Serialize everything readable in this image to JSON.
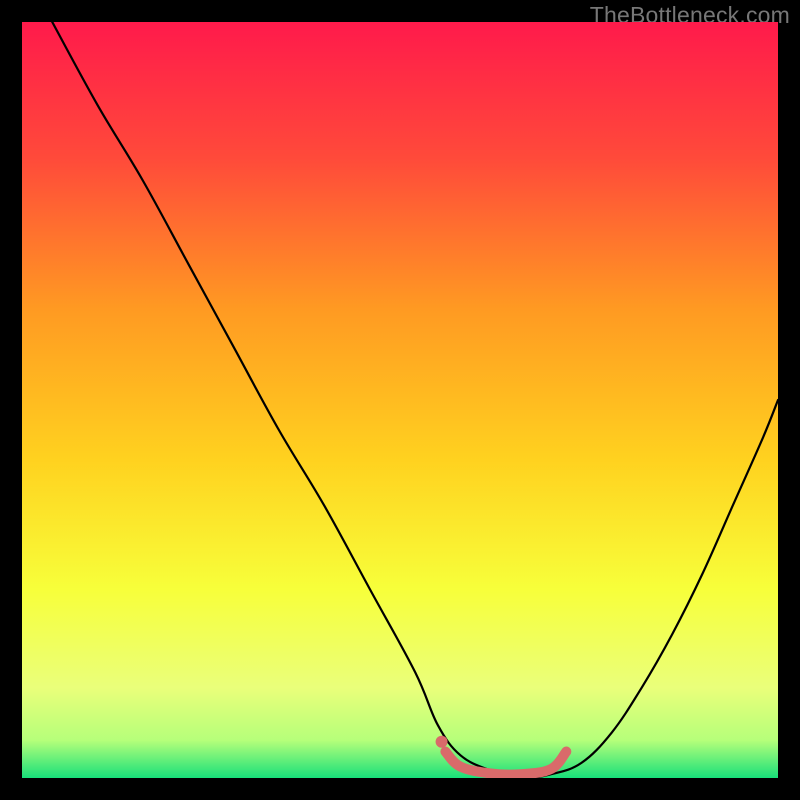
{
  "watermark": "TheBottleneck.com",
  "chart_data": {
    "type": "line",
    "title": "",
    "xlabel": "",
    "ylabel": "",
    "xlim": [
      0,
      100
    ],
    "ylim": [
      0,
      100
    ],
    "grid": false,
    "legend": false,
    "background_gradient": {
      "top_color": "#ff1a4b",
      "mid_colors": [
        "#ff6a2f",
        "#ffd21f",
        "#f7ff3a",
        "#eaff7a"
      ],
      "bottom_color": "#18e07a"
    },
    "series": [
      {
        "name": "bottleneck-curve",
        "color": "#000000",
        "stroke_width": 2.2,
        "x": [
          4,
          10,
          16,
          22,
          28,
          34,
          40,
          46,
          52,
          55,
          58,
          62,
          66,
          70,
          74,
          78,
          82,
          86,
          90,
          94,
          98,
          100
        ],
        "y": [
          100,
          89,
          79,
          68,
          57,
          46,
          36,
          25,
          14,
          7,
          3,
          1,
          0,
          0.5,
          2,
          6,
          12,
          19,
          27,
          36,
          45,
          50
        ]
      },
      {
        "name": "optimal-range-highlight",
        "color": "#d96a6a",
        "stroke_width": 10,
        "x": [
          56,
          58,
          62,
          66,
          70,
          72
        ],
        "y": [
          3.5,
          1.5,
          0.6,
          0.5,
          1.2,
          3.5
        ]
      },
      {
        "name": "optimal-range-dot",
        "color": "#d96a6a",
        "type_override": "scatter",
        "x": [
          55.5
        ],
        "y": [
          4.8
        ],
        "marker_radius": 6
      }
    ]
  }
}
